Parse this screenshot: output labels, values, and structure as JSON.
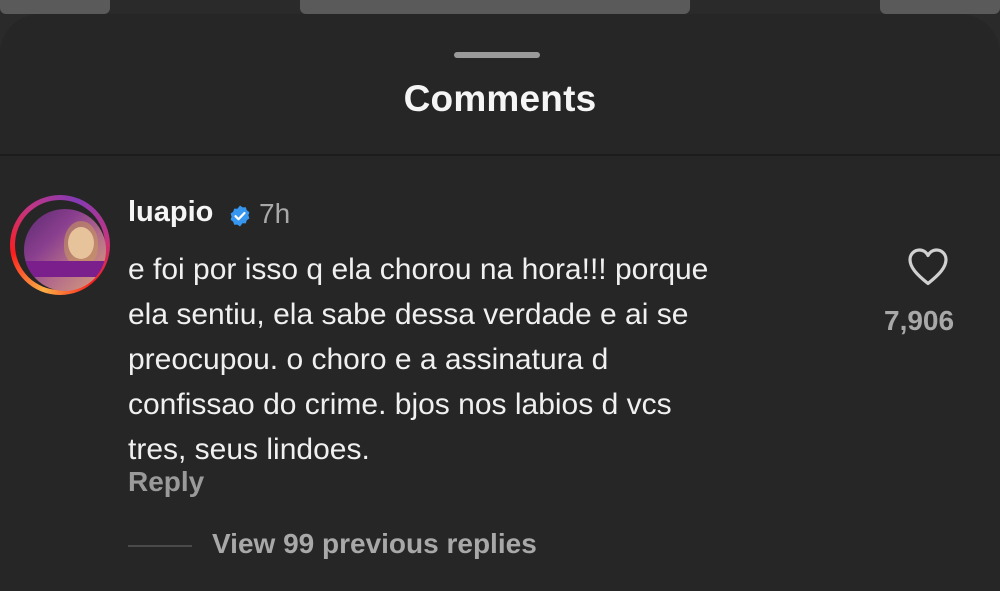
{
  "sheet": {
    "title": "Comments"
  },
  "comment": {
    "username": "luapio",
    "verified": true,
    "timestamp": "7h",
    "text_lines": [
      "e foi por isso q ela chorou na hora!!! porque",
      "ela sentiu, ela sabe dessa verdade e ai se",
      "preocupou. o choro e a assinatura d",
      "confissao do crime. bjos nos labios d vcs",
      "tres, seus lindoes."
    ],
    "like_count": "7,906",
    "like_icon": "heart-outline-icon",
    "reply_label": "Reply",
    "view_replies_label": "View 99 previous replies"
  },
  "colors": {
    "sheet_background": "#262626",
    "verified_badge": "#3797f0",
    "primary_text": "#f5f5f5",
    "secondary_text": "#a8a8a8"
  }
}
